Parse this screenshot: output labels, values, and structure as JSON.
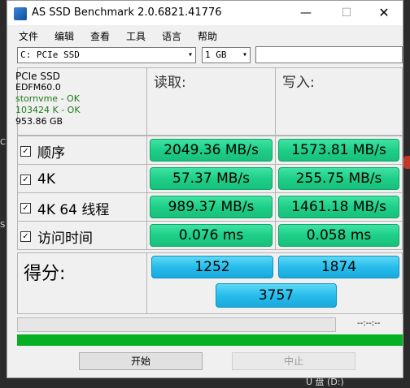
{
  "window": {
    "title": "AS SSD Benchmark 2.0.6821.41776",
    "minimize_glyph": "—",
    "maximize_glyph": "☐",
    "close_glyph": "✕"
  },
  "menu": [
    "文件",
    "编辑",
    "查看",
    "工具",
    "语言",
    "帮助"
  ],
  "toolbar": {
    "drive": "C: PCIe SSD",
    "size": "1 GB",
    "arrow": "▾"
  },
  "drive_info": {
    "name": "PCIe SSD",
    "firmware": "EDFM60.0",
    "driver": "stornvme - OK",
    "alignment": "103424 K - OK",
    "capacity": "953.86 GB"
  },
  "columns": {
    "read": "读取:",
    "write": "写入:"
  },
  "rows": [
    {
      "label": "顺序",
      "read": "2049.36 MB/s",
      "write": "1573.81 MB/s"
    },
    {
      "label": "4K",
      "read": "57.37 MB/s",
      "write": "255.75 MB/s"
    },
    {
      "label": "4K 64 线程",
      "read": "989.37 MB/s",
      "write": "1461.18 MB/s"
    },
    {
      "label": "访问时间",
      "read": "0.076 ms",
      "write": "0.058 ms"
    }
  ],
  "score": {
    "label": "得分:",
    "read": "1252",
    "write": "1874",
    "total": "3757"
  },
  "progress": {
    "timer": "--:--:--",
    "fraction": 1.0,
    "color": "#06b025"
  },
  "buttons": {
    "start": "开始",
    "stop": "中止"
  },
  "checkmark": "☑",
  "background": {
    "left_1": "C",
    "left_2": "S",
    "bottom": "U 盘 (D:)"
  }
}
